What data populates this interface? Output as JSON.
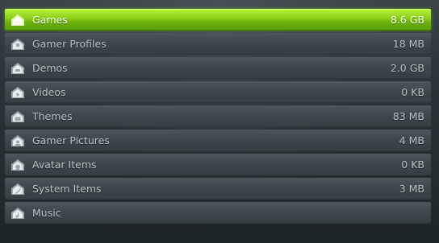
{
  "storage_list": {
    "items": [
      {
        "label": "Games",
        "size": "8.6 GB",
        "icon": "games-icon",
        "selected": true
      },
      {
        "label": "Gamer Profiles",
        "size": "18 MB",
        "icon": "gamer-profiles-icon",
        "selected": false
      },
      {
        "label": "Demos",
        "size": "2.0 GB",
        "icon": "demos-icon",
        "selected": false
      },
      {
        "label": "Videos",
        "size": "0 KB",
        "icon": "videos-icon",
        "selected": false
      },
      {
        "label": "Themes",
        "size": "83 MB",
        "icon": "themes-icon",
        "selected": false
      },
      {
        "label": "Gamer Pictures",
        "size": "4 MB",
        "icon": "gamer-pictures-icon",
        "selected": false
      },
      {
        "label": "Avatar Items",
        "size": "0 KB",
        "icon": "avatar-items-icon",
        "selected": false
      },
      {
        "label": "System Items",
        "size": "3 MB",
        "icon": "system-items-icon",
        "selected": false
      },
      {
        "label": "Music",
        "size": "",
        "icon": "music-icon",
        "selected": false
      }
    ]
  },
  "colors": {
    "selected_highlight": "#8fd21a",
    "row_background": "#3d484d",
    "text": "#b9c2c6"
  }
}
